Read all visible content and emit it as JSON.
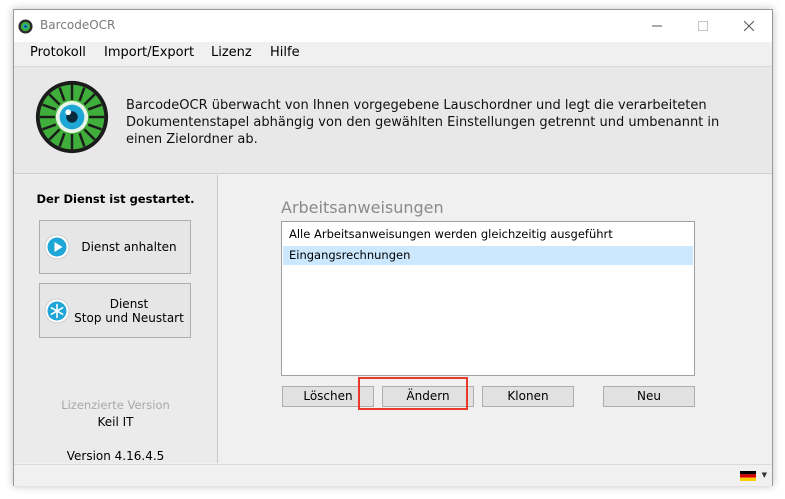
{
  "window": {
    "title": "BarcodeOCR"
  },
  "menu": [
    "Protokoll",
    "Import/Export",
    "Lizenz",
    "Hilfe"
  ],
  "header": {
    "description": "BarcodeOCR überwacht von Ihnen vorgegebene Lauschordner und legt die verarbeiteten Dokumentenstapel abhängig von den gewählten Einstellungen getrennt und umbenannt in einen Zielordner ab."
  },
  "sidebar": {
    "status": "Der Dienst ist gestartet.",
    "stop_button": "Dienst anhalten",
    "restart_button_line1": "Dienst",
    "restart_button_line2": "Stop und Neustart",
    "license_caption": "Lizenzierte Version",
    "license_name": "Keil IT",
    "version": "Version 4.16.4.5"
  },
  "main": {
    "section_title": "Arbeitsanweisungen",
    "items": [
      {
        "label": "Alle Arbeitsanweisungen werden gleichzeitig ausgeführt",
        "selected": false
      },
      {
        "label": "Eingangsrechnungen",
        "selected": true
      }
    ],
    "buttons": {
      "delete": "Löschen",
      "edit": "Ändern",
      "clone": "Klonen",
      "new": "Neu"
    }
  },
  "colors": {
    "selection": "#cce8ff",
    "highlight": "#e8392a",
    "logo_green": "#3fae3a",
    "logo_eye": "#1ea6d6"
  },
  "icons": {
    "app": "barcodeocr-app-icon",
    "stop": "play-circle-icon",
    "restart": "snowflake-restart-icon",
    "language": "german-flag-icon"
  }
}
